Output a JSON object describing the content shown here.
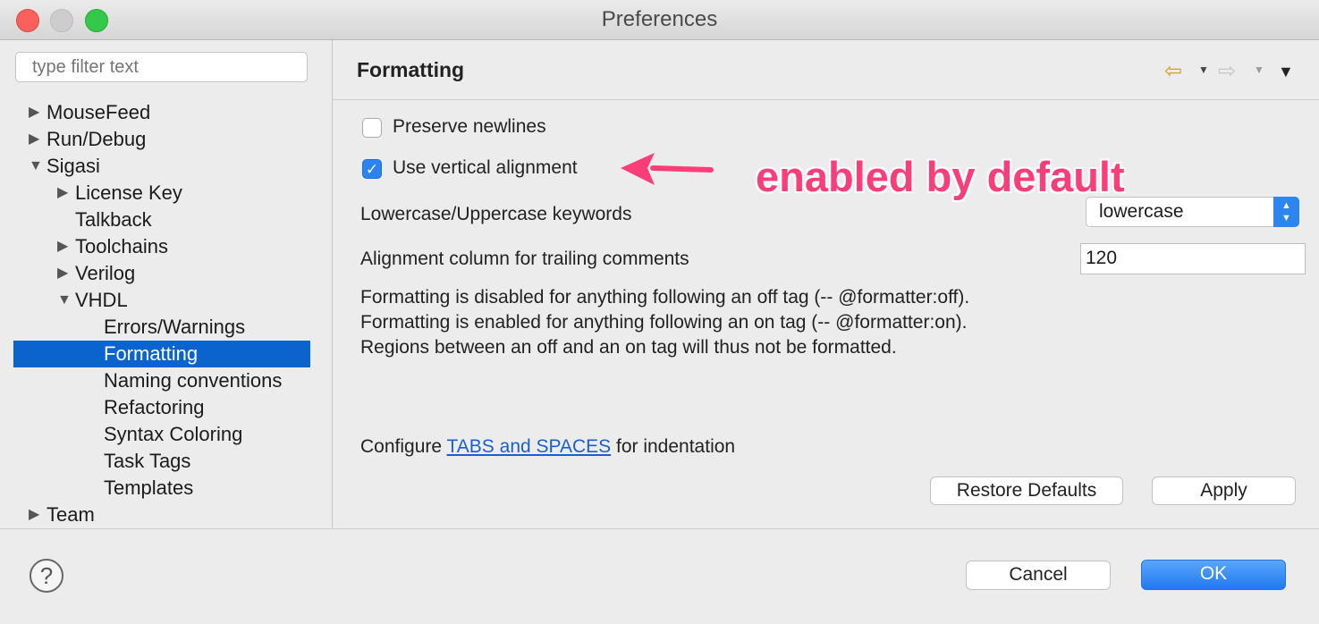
{
  "window": {
    "title": "Preferences"
  },
  "filter": {
    "placeholder": "type filter text"
  },
  "tree": [
    {
      "label": "MouseFeed",
      "arrow": "▶",
      "indent": 0
    },
    {
      "label": "Run/Debug",
      "arrow": "▶",
      "indent": 0
    },
    {
      "label": "Sigasi",
      "arrow": "▼",
      "indent": 0
    },
    {
      "label": "License Key",
      "arrow": "▶",
      "indent": 1
    },
    {
      "label": "Talkback",
      "arrow": "",
      "indent": 1
    },
    {
      "label": "Toolchains",
      "arrow": "▶",
      "indent": 1
    },
    {
      "label": "Verilog",
      "arrow": "▶",
      "indent": 1
    },
    {
      "label": "VHDL",
      "arrow": "▼",
      "indent": 1
    },
    {
      "label": "Errors/Warnings",
      "arrow": "",
      "indent": 2
    },
    {
      "label": "Formatting",
      "arrow": "",
      "indent": 2,
      "selected": true
    },
    {
      "label": "Naming conventions",
      "arrow": "",
      "indent": 2
    },
    {
      "label": "Refactoring",
      "arrow": "",
      "indent": 2
    },
    {
      "label": "Syntax Coloring",
      "arrow": "",
      "indent": 2
    },
    {
      "label": "Task Tags",
      "arrow": "",
      "indent": 2
    },
    {
      "label": "Templates",
      "arrow": "",
      "indent": 2
    },
    {
      "label": "Team",
      "arrow": "▶",
      "indent": 0
    }
  ],
  "page": {
    "title": "Formatting",
    "preserve_newlines": {
      "label": "Preserve newlines",
      "checked": false
    },
    "vertical_alignment": {
      "label": "Use vertical alignment",
      "checked": true
    },
    "keywords_label": "Lowercase/Uppercase keywords",
    "keywords_value": "lowercase",
    "alignment_label": "Alignment column for trailing comments",
    "alignment_value": "120",
    "info_line1": "Formatting is disabled for anything following an off tag (-- @formatter:off).",
    "info_line2": "Formatting is enabled for anything following an on tag (-- @formatter:on).",
    "info_line3": "Regions between an off and an on tag will thus not be formatted.",
    "configure_prefix": "Configure ",
    "configure_link": "TABS and SPACES",
    "configure_suffix": " for indentation",
    "restore_defaults": "Restore Defaults",
    "apply": "Apply"
  },
  "annotation": {
    "text": "enabled by default",
    "color": "#fb3e7a"
  },
  "footer": {
    "help": "?",
    "cancel": "Cancel",
    "ok": "OK"
  },
  "colors": {
    "accent": "#0b63ce",
    "ok_button": "#2079ef"
  }
}
